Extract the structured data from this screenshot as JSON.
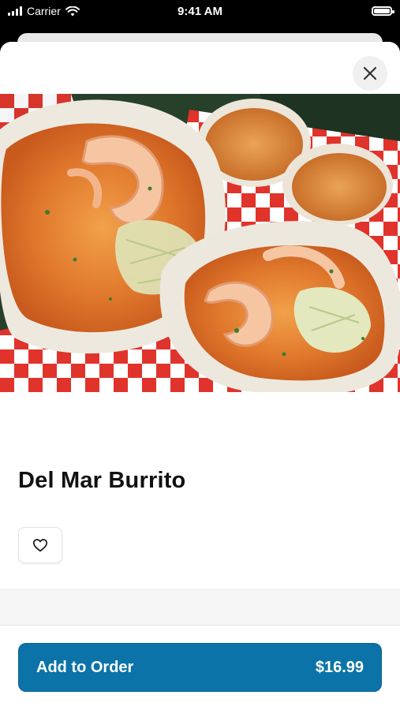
{
  "status_bar": {
    "carrier": "Carrier",
    "time": "9:41 AM",
    "icons": [
      "signal-icon",
      "wifi-icon",
      "battery-icon"
    ]
  },
  "item": {
    "image": "burrito-photo",
    "title": "Del Mar Burrito",
    "favorite_icon": "heart-outline-icon"
  },
  "actions": {
    "close_icon": "close-icon",
    "add_label": "Add to Order",
    "price": "$16.99"
  },
  "colors": {
    "accent": "#0c73a8",
    "sheet_bg": "#ffffff",
    "separator": "#f5f5f5"
  }
}
